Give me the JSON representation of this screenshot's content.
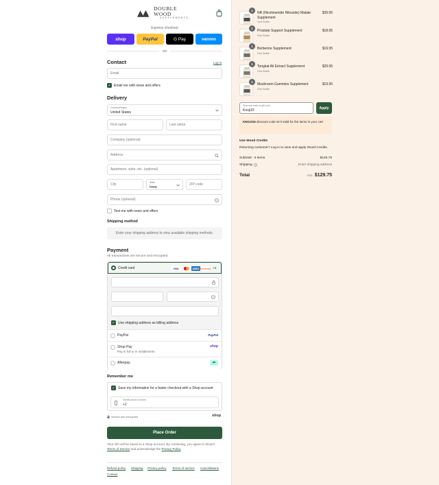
{
  "brand": {
    "name": "DOUBLE WOOD",
    "sub": "SUPPLEMENTS"
  },
  "express": {
    "title": "Express checkout",
    "buttons": [
      {
        "label": "shop",
        "color": "#5a31f4"
      },
      {
        "label": "PayPal",
        "color": "#ffc439"
      },
      {
        "label": "G Pay",
        "color": "#000000"
      },
      {
        "label": "venmo",
        "color": "#008cff"
      }
    ],
    "or": "OR"
  },
  "contact": {
    "title": "Contact",
    "login": "Log in",
    "email_placeholder": "Email",
    "news_label": "Email me with news and offers"
  },
  "delivery": {
    "title": "Delivery",
    "country_label": "Country/Region",
    "country_value": "United States",
    "first_name": "First name",
    "last_name": "Last name",
    "company": "Company (optional)",
    "address": "Address",
    "apartment": "Apartment, suite, etc. (optional)",
    "city": "City",
    "state_label": "State",
    "state_value": "Iowa",
    "zip": "ZIP code",
    "phone": "Phone (optional)",
    "text_label": "Text me with news and offers"
  },
  "shipping": {
    "title": "Shipping method",
    "message": "Enter your shipping address to view available shipping methods."
  },
  "payment": {
    "title": "Payment",
    "subtitle": "All transactions are secure and encrypted.",
    "credit_card": "Credit card",
    "more_cards": "+4",
    "billing_label": "Use shipping address as billing address",
    "paypal": "PayPal",
    "shop_pay": "Shop Pay",
    "shop_pay_sub": "Pay in full or in installments",
    "afterpay": "Afterpay"
  },
  "remember": {
    "title": "Remember me",
    "save_label": "Save my information for a faster checkout with a Shop account",
    "mobile_label": "Mobile phone number",
    "mobile_value": "+1",
    "secure": "Secure and encrypted",
    "shop": "shop"
  },
  "place_order": "Place Order",
  "disclaimer": {
    "part1": "Your info will be saved to a Shop account. By continuing, you agree to Shop's ",
    "terms": "Terms of Service",
    "part2": " and acknowledge the ",
    "privacy": "Privacy Policy",
    "part3": "."
  },
  "footer": [
    "Refund policy",
    "Shipping",
    "Privacy policy",
    "Terms of service",
    "Cancellations",
    "Contact"
  ],
  "cart": {
    "items": [
      {
        "name": "NR (Nicotinamide Riboside) Malate Supplement",
        "sub": "One Bottle",
        "price": "$39.95",
        "qty": "1"
      },
      {
        "name": "Prostate Support Supplement",
        "sub": "One Bottle",
        "price": "$18.95",
        "qty": "1"
      },
      {
        "name": "Berberine Supplement",
        "sub": "One Bottle",
        "price": "$19.95",
        "qty": "1"
      },
      {
        "name": "Tongkat Ali Extract Supplement",
        "sub": "One Bottle",
        "price": "$29.95",
        "qty": "1"
      },
      {
        "name": "Mushroom Gummies Supplement",
        "sub": "One Bottle",
        "price": "$19.95",
        "qty": "1"
      }
    ],
    "discount_label": "Discount code or gift card",
    "discount_value": "Knoji15",
    "apply": "Apply",
    "warning_code": "KNOJI15",
    "warning_text": " discount code isn't valid for the items in your cart",
    "credits_title": "Use Wood Credits",
    "credits_text": "Returning customer? Log in to view and apply Wood Credits.",
    "subtotal_label": "Subtotal · 5 items",
    "subtotal_value": "$129.75",
    "shipping_label": "Shipping",
    "shipping_value": "Enter shipping address",
    "total_label": "Total",
    "currency": "USD",
    "total_value": "$129.75"
  }
}
